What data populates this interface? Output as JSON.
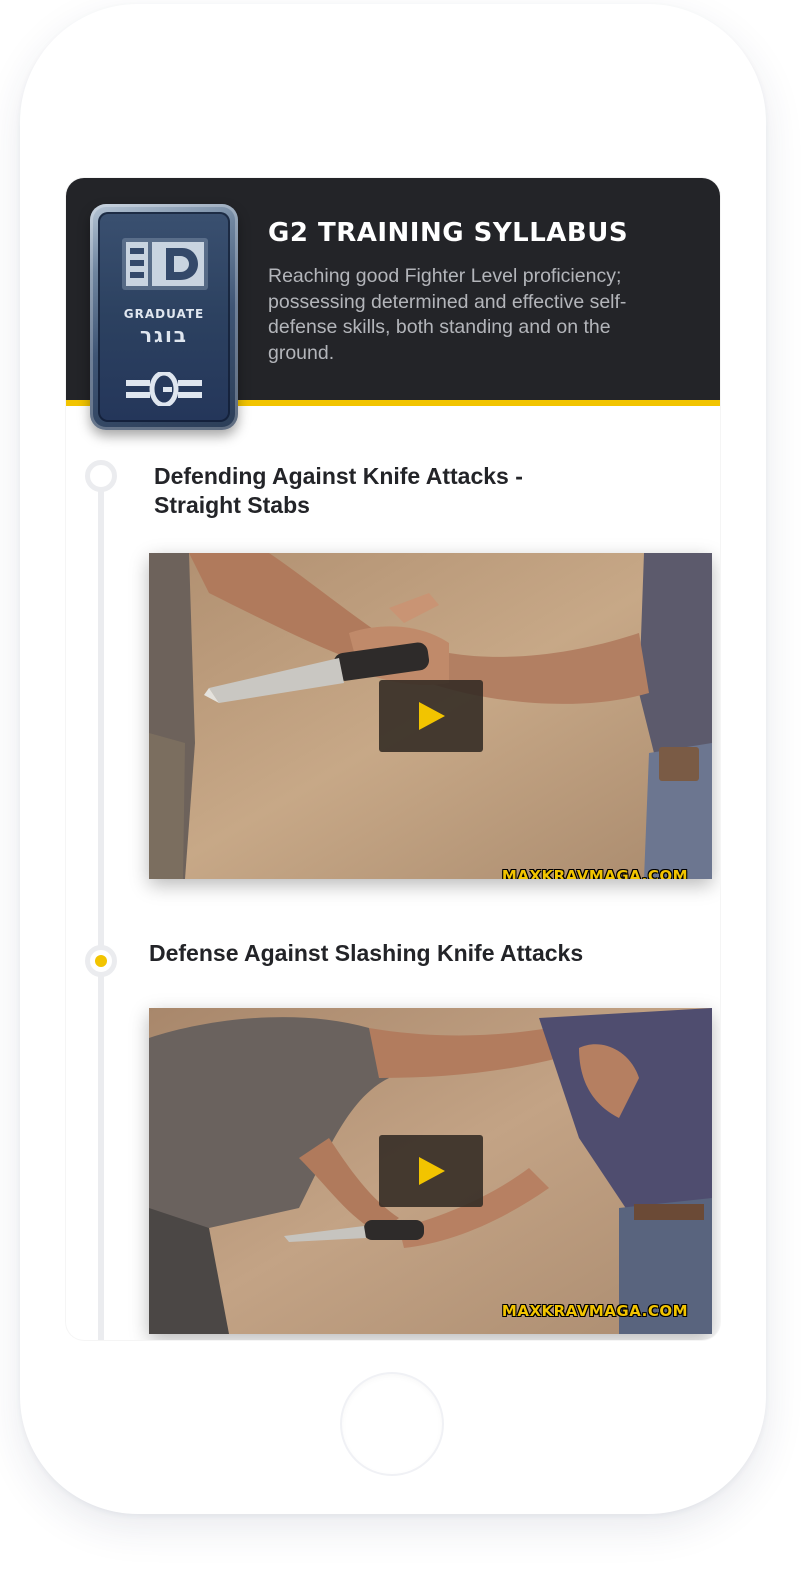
{
  "header": {
    "title": "G2 TRAINING SYLLABUS",
    "description": "Reaching good Fighter Level proficiency; possessing determined and effective self-defense skills, both standing and on the ground."
  },
  "badge": {
    "logo_text": "KMG",
    "graduate_label": "GRADUATE",
    "hebrew_label": "בוגר",
    "rank": "G"
  },
  "lessons": [
    {
      "title": "Defending Against Knife Attacks - Straight Stabs",
      "status": "not-started",
      "video": {
        "watermark": "MAXKRAVMAGA.COM",
        "play_icon": "play-icon"
      }
    },
    {
      "title": "Defense Against Slashing Knife Attacks",
      "status": "current",
      "video": {
        "watermark": "MAXKRAVMAGA.COM",
        "play_icon": "play-icon"
      }
    }
  ],
  "colors": {
    "accent": "#f2c400",
    "header_bg": "#232428",
    "timeline": "#ebecef"
  }
}
